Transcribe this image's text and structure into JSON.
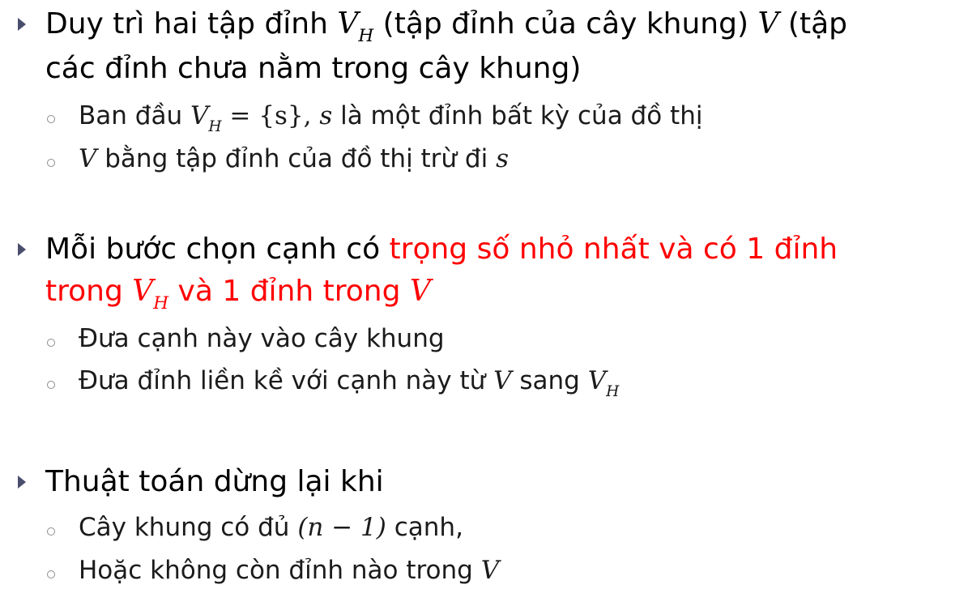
{
  "items": [
    {
      "text_before": "Duy trì hai tập đỉnh ",
      "math_1": "V",
      "math_1_sub": "H",
      "text_mid": " (tập đỉnh của cây khung) ",
      "math_2": "V",
      "text_after": " (tập",
      "text_line2": "các đỉnh chưa nằm trong cây khung)",
      "subitems": [
        {
          "text_before": "Ban đầu ",
          "math": "V",
          "math_sub": "H",
          "text_mid": " = {s}, ",
          "math_2": "s",
          "text_after": " là một đỉnh bất kỳ của đồ thị"
        },
        {
          "math": "V",
          "text_after": " bằng tập đỉnh của đồ thị trừ đi ",
          "math_2": "s"
        }
      ]
    },
    {
      "text_before": "Mỗi bước chọn cạnh có ",
      "red_text": "trọng số nhỏ nhất và có 1 đỉnh",
      "red_line2_before": "trong ",
      "red_math_1": "V",
      "red_math_1_sub": "H",
      "red_line2_mid": " và 1 đỉnh trong ",
      "red_math_2": "V",
      "subitems": [
        {
          "text": "Đưa cạnh này vào cây khung"
        },
        {
          "text_before": "Đưa đỉnh liền kề với cạnh này từ ",
          "math": "V",
          "text_mid": " sang ",
          "math_2": "V",
          "math_2_sub": "H"
        }
      ]
    },
    {
      "text": "Thuật toán dừng lại khi",
      "subitems": [
        {
          "text_before": "Cây khung có đủ ",
          "math": "(n − 1)",
          "text_after": " cạnh,"
        },
        {
          "text_before": "Hoặc không còn đỉnh nào trong ",
          "math": "V"
        }
      ]
    }
  ]
}
